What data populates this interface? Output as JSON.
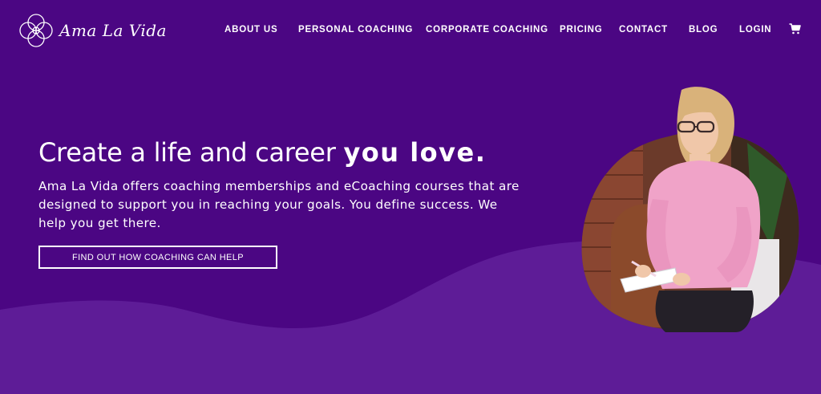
{
  "brand": {
    "name": "Ama La Vida"
  },
  "nav": {
    "items": [
      {
        "label": "ABOUT US"
      },
      {
        "label": "PERSONAL COACHING"
      },
      {
        "label": "CORPORATE COACHING"
      },
      {
        "label": "PRICING"
      },
      {
        "label": "CONTACT"
      },
      {
        "label": "BLOG"
      },
      {
        "label": "LOGIN"
      }
    ],
    "cart_icon": "cart-icon"
  },
  "hero": {
    "headline_regular": "Create a life and career ",
    "headline_bold": "you love.",
    "subtext": "Ama La Vida offers coaching memberships and eCoaching courses that are designed to support you in reaching your goals. You define success. We help you get there.",
    "cta_label": "FIND OUT HOW COACHING CAN HELP"
  },
  "colors": {
    "background": "#4b0683",
    "wave": "#5e1c97",
    "text": "#ffffff"
  }
}
